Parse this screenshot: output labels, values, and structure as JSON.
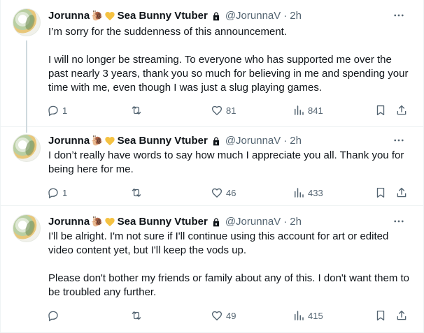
{
  "tweets": [
    {
      "display_name": "Jorunna",
      "name_suffix": "Sea Bunny Vtuber",
      "handle": "@JorunnaV",
      "separator": "·",
      "time": "2h",
      "paragraphs": [
        "I’m sorry for the suddenness of this announcement.",
        "I will no longer be streaming. To everyone who has supported me over the past nearly 3 years, thank you so much for believing in me and spending your time with me, even though I was just a slug playing games."
      ],
      "replies": "1",
      "retweets": "",
      "likes": "81",
      "views": "841"
    },
    {
      "display_name": "Jorunna",
      "name_suffix": "Sea Bunny Vtuber",
      "handle": "@JorunnaV",
      "separator": "·",
      "time": "2h",
      "paragraphs": [
        "I don’t really have words to say how much I appreciate you all. Thank you for being here for me."
      ],
      "replies": "1",
      "retweets": "",
      "likes": "46",
      "views": "433"
    },
    {
      "display_name": "Jorunna",
      "name_suffix": "Sea Bunny Vtuber",
      "handle": "@JorunnaV",
      "separator": "·",
      "time": "2h",
      "paragraphs": [
        "I'll be alright. I'm not sure if I'll continue using this account for art or edited video content yet, but I'll keep the vods up.",
        "Please don't bother my friends or family about any of this. I don't want them to be troubled any further."
      ],
      "replies": "",
      "retweets": "",
      "likes": "49",
      "views": "415"
    }
  ],
  "icons": {
    "name_emoji_1": "snail-emoji",
    "name_emoji_2": "yellow-heart-emoji",
    "verified_lock": "lock-icon",
    "more": "more-icon",
    "reply": "reply-icon",
    "retweet": "retweet-icon",
    "like": "like-icon",
    "views": "views-icon",
    "bookmark": "bookmark-icon",
    "share": "share-icon"
  },
  "colors": {
    "text": "#0f1419",
    "secondary": "#536471",
    "divider": "#eff3f4",
    "thread_line": "#cfd9de",
    "heart": "#f5c242"
  }
}
